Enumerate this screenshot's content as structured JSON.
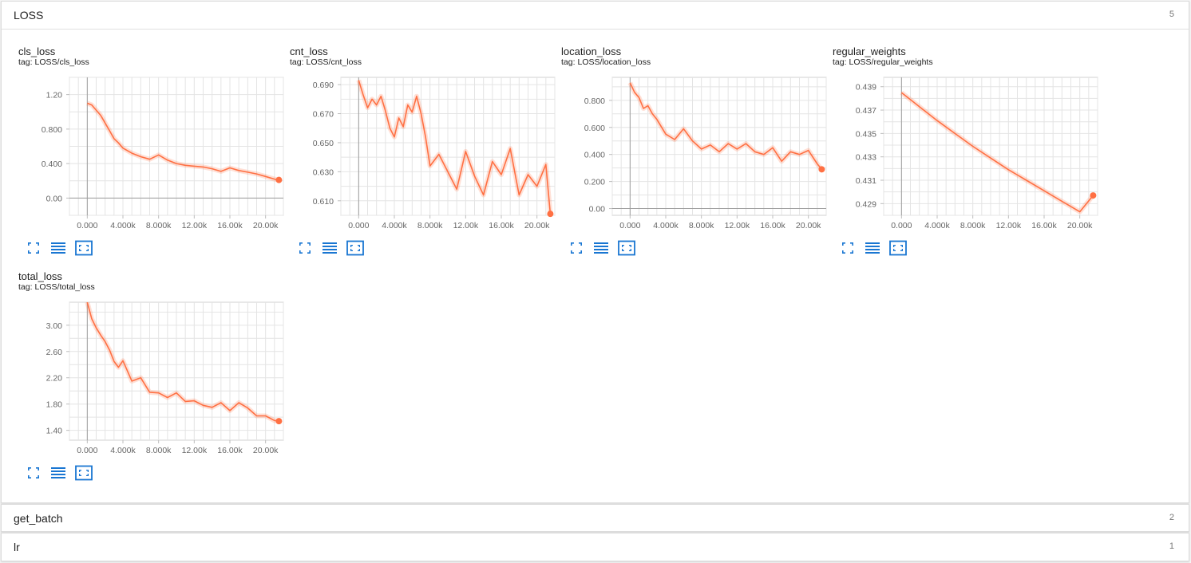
{
  "accent_color": "#ff7043",
  "icon_color": "#1976d2",
  "categories": [
    {
      "name": "LOSS",
      "count": "5"
    },
    {
      "name": "get_batch",
      "count": "2"
    },
    {
      "name": "lr",
      "count": "1"
    }
  ],
  "cards": [
    {
      "title": "cls_loss",
      "tag_prefix": "tag:",
      "tag": "LOSS/cls_loss"
    },
    {
      "title": "cnt_loss",
      "tag_prefix": "tag:",
      "tag": "LOSS/cnt_loss"
    },
    {
      "title": "location_loss",
      "tag_prefix": "tag:",
      "tag": "LOSS/location_loss"
    },
    {
      "title": "regular_weights",
      "tag_prefix": "tag:",
      "tag": "LOSS/regular_weights"
    },
    {
      "title": "total_loss",
      "tag_prefix": "tag:",
      "tag": "LOSS/total_loss"
    }
  ],
  "card_buttons": [
    "fit-to-screen-icon",
    "toggle-log-scale-icon",
    "fit-domain-icon"
  ],
  "chart_data": [
    {
      "type": "line",
      "title": "cls_loss",
      "xlim": [
        -2000,
        22000
      ],
      "ylim": [
        -0.2,
        1.4
      ],
      "xticks": [
        0,
        4000,
        8000,
        12000,
        16000,
        20000
      ],
      "xtick_labels": [
        "0.000",
        "4.000k",
        "8.000k",
        "12.00k",
        "16.00k",
        "20.00k"
      ],
      "yticks": [
        0,
        0.4,
        0.8,
        1.2
      ],
      "ytick_labels": [
        "0.00",
        "0.400",
        "0.800",
        "1.20"
      ],
      "series": [
        {
          "x": [
            0,
            500,
            1000,
            1500,
            2000,
            2500,
            3000,
            3500,
            4000,
            5000,
            6000,
            7000,
            8000,
            9000,
            10000,
            11000,
            12000,
            13000,
            14000,
            15000,
            16000,
            17000,
            18000,
            19000,
            20000,
            21000,
            21500
          ],
          "y": [
            1.1,
            1.08,
            1.02,
            0.96,
            0.87,
            0.78,
            0.69,
            0.64,
            0.58,
            0.52,
            0.48,
            0.45,
            0.5,
            0.44,
            0.4,
            0.38,
            0.37,
            0.36,
            0.34,
            0.31,
            0.35,
            0.32,
            0.3,
            0.28,
            0.25,
            0.22,
            0.21
          ]
        }
      ]
    },
    {
      "type": "line",
      "title": "cnt_loss",
      "xlim": [
        -2000,
        22000
      ],
      "ylim": [
        0.6,
        0.695
      ],
      "xticks": [
        0,
        4000,
        8000,
        12000,
        16000,
        20000
      ],
      "xtick_labels": [
        "0.000",
        "4.000k",
        "8.000k",
        "12.00k",
        "16.00k",
        "20.00k"
      ],
      "yticks": [
        0.61,
        0.63,
        0.65,
        0.67,
        0.69
      ],
      "ytick_labels": [
        "0.610",
        "0.630",
        "0.650",
        "0.670",
        "0.690"
      ],
      "series": [
        {
          "x": [
            0,
            500,
            1000,
            1500,
            2000,
            2500,
            3000,
            3500,
            4000,
            4500,
            5000,
            5500,
            6000,
            6500,
            7000,
            7500,
            8000,
            9000,
            10000,
            11000,
            12000,
            13000,
            14000,
            15000,
            16000,
            17000,
            18000,
            19000,
            20000,
            21000,
            21500
          ],
          "y": [
            0.693,
            0.683,
            0.674,
            0.68,
            0.676,
            0.682,
            0.672,
            0.66,
            0.654,
            0.667,
            0.661,
            0.676,
            0.671,
            0.682,
            0.67,
            0.654,
            0.634,
            0.642,
            0.63,
            0.618,
            0.644,
            0.627,
            0.614,
            0.637,
            0.628,
            0.646,
            0.614,
            0.628,
            0.62,
            0.635,
            0.601
          ]
        }
      ]
    },
    {
      "type": "line",
      "title": "location_loss",
      "xlim": [
        -2000,
        22000
      ],
      "ylim": [
        -0.05,
        0.97
      ],
      "xticks": [
        0,
        4000,
        8000,
        12000,
        16000,
        20000
      ],
      "xtick_labels": [
        "0.000",
        "4.000k",
        "8.000k",
        "12.00k",
        "16.00k",
        "20.00k"
      ],
      "yticks": [
        0,
        0.2,
        0.4,
        0.6,
        0.8
      ],
      "ytick_labels": [
        "0.00",
        "0.200",
        "0.400",
        "0.600",
        "0.800"
      ],
      "series": [
        {
          "x": [
            0,
            500,
            1000,
            1500,
            2000,
            2500,
            3000,
            4000,
            5000,
            6000,
            7000,
            8000,
            9000,
            10000,
            11000,
            12000,
            13000,
            14000,
            15000,
            16000,
            17000,
            18000,
            19000,
            20000,
            21000,
            21500
          ],
          "y": [
            0.93,
            0.86,
            0.82,
            0.74,
            0.76,
            0.7,
            0.66,
            0.55,
            0.51,
            0.59,
            0.5,
            0.44,
            0.47,
            0.42,
            0.48,
            0.44,
            0.48,
            0.42,
            0.4,
            0.45,
            0.35,
            0.42,
            0.4,
            0.43,
            0.33,
            0.29
          ]
        }
      ]
    },
    {
      "type": "line",
      "title": "regular_weights",
      "xlim": [
        -2000,
        22000
      ],
      "ylim": [
        0.428,
        0.4398
      ],
      "xticks": [
        0,
        4000,
        8000,
        12000,
        16000,
        20000
      ],
      "xtick_labels": [
        "0.000",
        "4.000k",
        "8.000k",
        "12.00k",
        "16.00k",
        "20.00k"
      ],
      "yticks": [
        0.429,
        0.431,
        0.433,
        0.435,
        0.437,
        0.439
      ],
      "ytick_labels": [
        "0.429",
        "0.431",
        "0.433",
        "0.435",
        "0.437",
        "0.439"
      ],
      "series": [
        {
          "x": [
            0,
            2000,
            4000,
            6000,
            8000,
            10000,
            12000,
            14000,
            16000,
            18000,
            20000,
            21500
          ],
          "y": [
            0.4385,
            0.4373,
            0.4361,
            0.435,
            0.4339,
            0.4329,
            0.4319,
            0.431,
            0.4301,
            0.4292,
            0.4283,
            0.4297
          ]
        }
      ]
    },
    {
      "type": "line",
      "title": "total_loss",
      "xlim": [
        -2000,
        22000
      ],
      "ylim": [
        1.25,
        3.35
      ],
      "xticks": [
        0,
        4000,
        8000,
        12000,
        16000,
        20000
      ],
      "xtick_labels": [
        "0.000",
        "4.000k",
        "8.000k",
        "12.00k",
        "16.00k",
        "20.00k"
      ],
      "yticks": [
        1.4,
        1.8,
        2.2,
        2.6,
        3.0
      ],
      "ytick_labels": [
        "1.40",
        "1.80",
        "2.20",
        "2.60",
        "3.00"
      ],
      "series": [
        {
          "x": [
            0,
            500,
            1000,
            1500,
            2000,
            2500,
            3000,
            3500,
            4000,
            5000,
            6000,
            7000,
            8000,
            9000,
            10000,
            11000,
            12000,
            13000,
            14000,
            15000,
            16000,
            17000,
            18000,
            19000,
            20000,
            21000,
            21500
          ],
          "y": [
            3.35,
            3.1,
            2.96,
            2.85,
            2.75,
            2.62,
            2.45,
            2.36,
            2.46,
            2.15,
            2.2,
            1.98,
            1.97,
            1.9,
            1.97,
            1.84,
            1.85,
            1.78,
            1.75,
            1.82,
            1.7,
            1.82,
            1.74,
            1.62,
            1.62,
            1.55,
            1.54
          ]
        }
      ]
    }
  ]
}
